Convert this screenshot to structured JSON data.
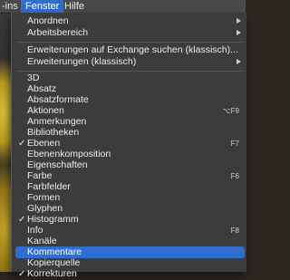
{
  "menubar": {
    "items": [
      {
        "label": "-ins"
      },
      {
        "label": "Fenster"
      },
      {
        "label": "Hilfe"
      }
    ]
  },
  "menu": {
    "group1": [
      {
        "label": "Anordnen"
      },
      {
        "label": "Arbeitsbereich"
      }
    ],
    "group2": [
      {
        "label": "Erweiterungen auf Exchange suchen (klassisch)..."
      },
      {
        "label": "Erweiterungen (klassisch)"
      }
    ],
    "items": [
      {
        "label": "3D"
      },
      {
        "label": "Absatz"
      },
      {
        "label": "Absatzformate"
      },
      {
        "label": "Aktionen",
        "shortcut": "⌥F9"
      },
      {
        "label": "Anmerkungen"
      },
      {
        "label": "Bibliotheken"
      },
      {
        "label": "Ebenen",
        "shortcut": "F7",
        "checked": "✓"
      },
      {
        "label": "Ebenenkomposition"
      },
      {
        "label": "Eigenschaften"
      },
      {
        "label": "Farbe",
        "shortcut": "F6"
      },
      {
        "label": "Farbfelder"
      },
      {
        "label": "Formen"
      },
      {
        "label": "Glyphen"
      },
      {
        "label": "Histogramm",
        "checked": "✓"
      },
      {
        "label": "Info",
        "shortcut": "F8"
      },
      {
        "label": "Kanäle"
      },
      {
        "label": "Kommentare"
      },
      {
        "label": "Kopierquelle"
      },
      {
        "label": "Korrekturen",
        "checked": "✓"
      }
    ]
  }
}
